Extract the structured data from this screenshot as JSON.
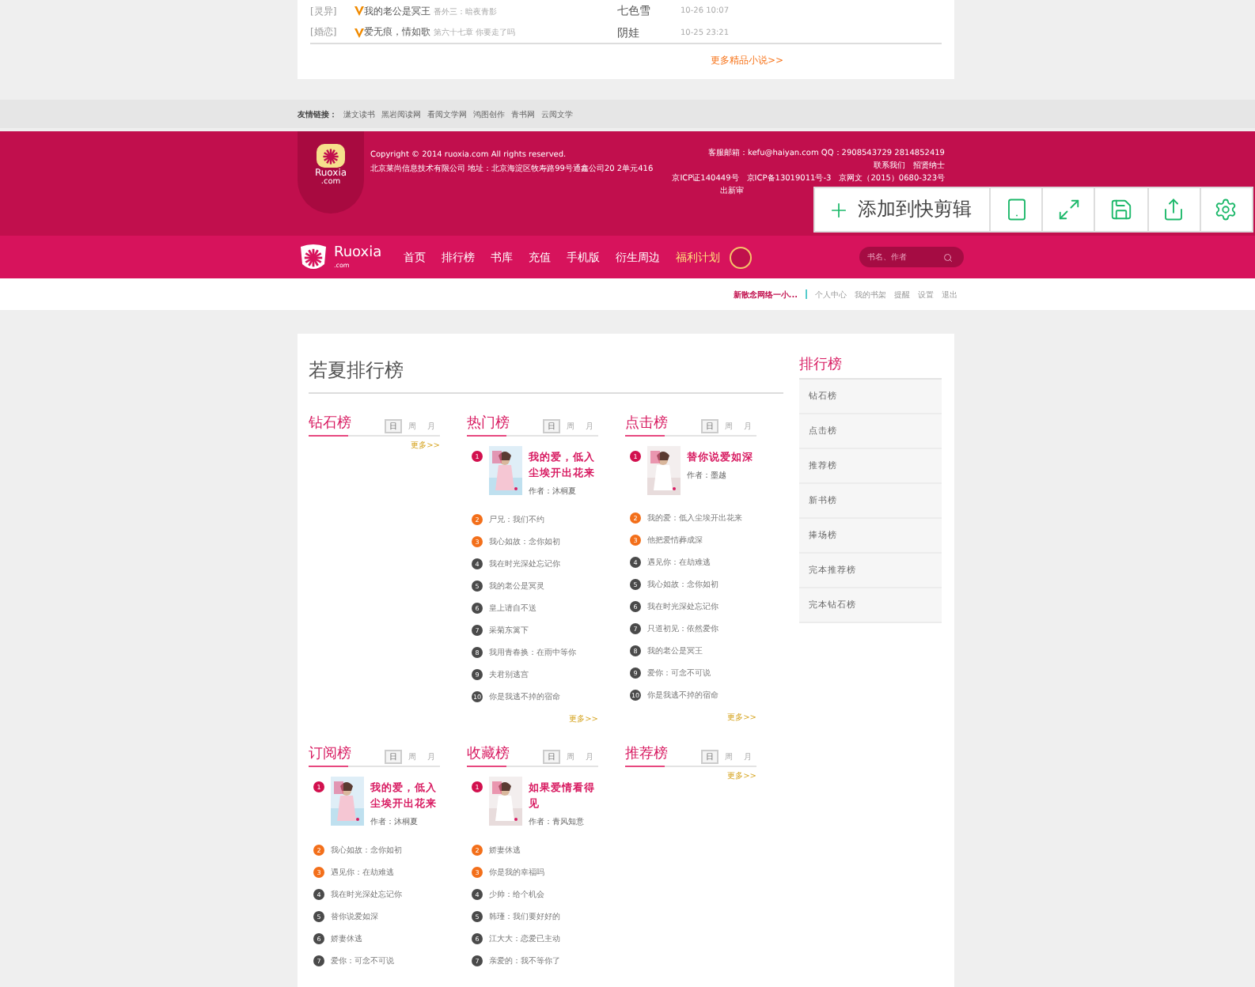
{
  "latest": {
    "rows": [
      {
        "tag": "[灵异]",
        "title": "我的老公是冥王",
        "chapter": "番外三：暗夜青影",
        "author": "七色雪",
        "time": "10-26 10:07"
      },
      {
        "tag": "[婚恋]",
        "title": "爱无痕，情如歌",
        "chapter": "第六十七章 你要走了吗",
        "author": "阴娃",
        "time": "10-25 23:21"
      }
    ],
    "more": "更多精品小说>>"
  },
  "friend_links": {
    "label": "友情链接：",
    "links": [
      "潇文读书",
      "黑岩阅读网",
      "看阅文学网",
      "鸿图创作",
      "青书网",
      "云阅文学"
    ]
  },
  "footer": {
    "logo_name": "Ruoxia",
    "logo_domain": ".com",
    "copyright": "Copyright © 2014 ruoxia.com All rights reserved.",
    "company": "北京莱尚信息技术有限公司  地址：北京海淀区牧寿路99号通鑫公司20 2单元416",
    "contact": "客服邮箱：kefu@haiyan.com  QQ：2908543729 2814852419",
    "links": [
      "联系我们",
      "招贤纳士"
    ],
    "licenses": [
      "京ICP证140449号",
      "京ICP备13019011号-3",
      "京网文（2015）0680-323号"
    ],
    "license_cut": "出新审"
  },
  "nav": {
    "logo_name": "Ruoxia",
    "logo_domain": ".com",
    "items": [
      {
        "label": "首页",
        "highlight": false
      },
      {
        "label": "排行榜",
        "highlight": false
      },
      {
        "label": "书库",
        "highlight": false
      },
      {
        "label": "充值",
        "highlight": false
      },
      {
        "label": "手机版",
        "highlight": false
      },
      {
        "label": "衍生周边",
        "highlight": false
      },
      {
        "label": "福利计划",
        "highlight": true
      }
    ],
    "search": {
      "placeholder": "书名、作者"
    }
  },
  "user_bar": {
    "user": "新散念网络一小...",
    "links": [
      "个人中心",
      "我的书架",
      "提醒",
      "设置",
      "退出"
    ]
  },
  "toolbar": {
    "add_label": "添加到快剪辑"
  },
  "rankings": {
    "title": "若夏排行榜",
    "boards": [
      {
        "title": "钻石榜",
        "periods": [
          {
            "label": "日",
            "selected": true
          },
          {
            "label": "周",
            "selected": false
          },
          {
            "label": "月",
            "selected": false
          }
        ],
        "more": "更多>>"
      },
      {
        "title": "热门榜",
        "periods": [
          {
            "label": "日",
            "selected": true
          },
          {
            "label": "周",
            "selected": false
          },
          {
            "label": "月",
            "selected": false
          }
        ],
        "top": {
          "rank": "1",
          "title": "我的爱，低入尘埃开出花来",
          "author": "作者：沐桐夏"
        },
        "items": [
          {
            "rank": "2",
            "title": "尸兄：我们不约"
          },
          {
            "rank": "3",
            "title": "我心如故：念你如初"
          },
          {
            "rank": "4",
            "title": "我在时光深处忘记你"
          },
          {
            "rank": "5",
            "title": "我的老公是冥灵"
          },
          {
            "rank": "6",
            "title": "皇上请自不送"
          },
          {
            "rank": "7",
            "title": "采菊东篱下"
          },
          {
            "rank": "8",
            "title": "我用青春换：在雨中等你"
          },
          {
            "rank": "9",
            "title": "夫君别逃宫"
          },
          {
            "rank": "10",
            "title": "你是我逃不掉的宿命"
          }
        ],
        "more": "更多>>"
      },
      {
        "title": "点击榜",
        "periods": [
          {
            "label": "日",
            "selected": true
          },
          {
            "label": "周",
            "selected": false
          },
          {
            "label": "月",
            "selected": false
          }
        ],
        "top": {
          "rank": "1",
          "title": "替你说爱如深",
          "author": "作者：墨越"
        },
        "items": [
          {
            "rank": "2",
            "title": "我的爱：低入尘埃开出花来"
          },
          {
            "rank": "3",
            "title": "他把爱情葬成深"
          },
          {
            "rank": "4",
            "title": "遇见你：在劫难逃"
          },
          {
            "rank": "5",
            "title": "我心如故：念你如初"
          },
          {
            "rank": "6",
            "title": "我在时光深处忘记你"
          },
          {
            "rank": "7",
            "title": "只道初见：依然爱你"
          },
          {
            "rank": "8",
            "title": "我的老公是冥王"
          },
          {
            "rank": "9",
            "title": "爱你：可念不可说"
          },
          {
            "rank": "10",
            "title": "你是我逃不掉的宿命"
          }
        ],
        "more": "更多>>"
      },
      {
        "title": "订阅榜",
        "periods": [
          {
            "label": "日",
            "selected": true
          },
          {
            "label": "周",
            "selected": false
          },
          {
            "label": "月",
            "selected": false
          }
        ],
        "top": {
          "rank": "1",
          "title": "我的爱，低入尘埃开出花来",
          "author": "作者：沐桐夏"
        },
        "items": [
          {
            "rank": "2",
            "title": "我心如故：念你如初"
          },
          {
            "rank": "3",
            "title": "遇见你：在劫难逃"
          },
          {
            "rank": "4",
            "title": "我在时光深处忘记你"
          },
          {
            "rank": "5",
            "title": "替你说爱如深"
          },
          {
            "rank": "6",
            "title": "娇妻休逃"
          },
          {
            "rank": "7",
            "title": "爱你：可念不可说"
          }
        ]
      },
      {
        "title": "收藏榜",
        "periods": [
          {
            "label": "日",
            "selected": true
          },
          {
            "label": "周",
            "selected": false
          },
          {
            "label": "月",
            "selected": false
          }
        ],
        "top": {
          "rank": "1",
          "title": "如果爱情看得见",
          "author": "作者：青风知意"
        },
        "items": [
          {
            "rank": "2",
            "title": "娇妻休逃"
          },
          {
            "rank": "3",
            "title": "你是我的幸福吗"
          },
          {
            "rank": "4",
            "title": "少帅：给个机会"
          },
          {
            "rank": "5",
            "title": "韩瑾：我们要好好的"
          },
          {
            "rank": "6",
            "title": "江大大：恋爱已主动"
          },
          {
            "rank": "7",
            "title": "亲爱的：我不等你了"
          }
        ]
      },
      {
        "title": "推荐榜",
        "periods": [
          {
            "label": "日",
            "selected": true
          },
          {
            "label": "周",
            "selected": false
          },
          {
            "label": "月",
            "selected": false
          }
        ],
        "more": "更多>>"
      }
    ]
  },
  "sidebar": {
    "title": "排行榜",
    "items": [
      "钻石榜",
      "点击榜",
      "推荐榜",
      "新书榜",
      "捧场榜",
      "完本推荐榜",
      "完本钻石榜"
    ]
  }
}
